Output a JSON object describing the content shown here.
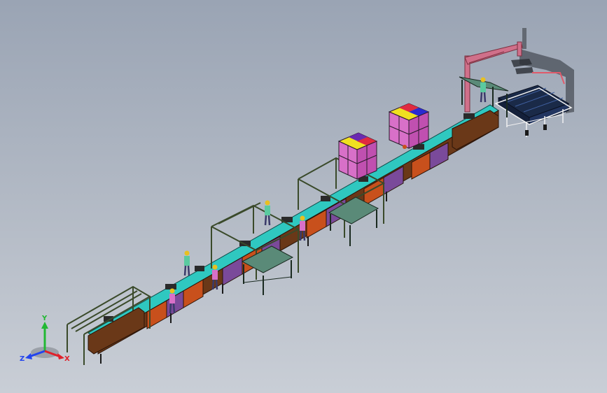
{
  "triad": {
    "x_label": "X",
    "y_label": "Y",
    "z_label": "Z",
    "x_color": "#e0202a",
    "y_color": "#22b833",
    "z_color": "#2244ee"
  },
  "colors": {
    "frame": "#3a4a2a",
    "frame_dark": "#263018",
    "conveyor_top": "#2fc8c0",
    "panel_purple": "#7a4a9a",
    "panel_orange": "#c8501c",
    "panel_brown": "#6a3818",
    "pink_crane": "#d0708a",
    "magenta_box": "#d870c8",
    "table_green": "#5a8a78",
    "tray_blue": "#1a2a48"
  }
}
